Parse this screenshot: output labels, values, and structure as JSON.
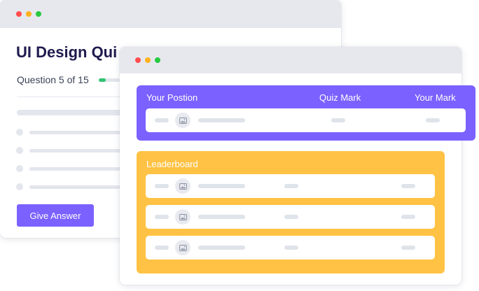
{
  "back_window": {
    "title": "UI Design Qui",
    "question_progress": "Question 5 of 15",
    "progress_fraction": 0.33,
    "answer_button_label": "Give Answer"
  },
  "front_window": {
    "position_table": {
      "col_position": "Your Postion",
      "col_quiz_mark": "Quiz Mark",
      "col_your_mark": "Your Mark"
    },
    "leaderboard": {
      "title": "Leaderboard"
    }
  },
  "icons": {
    "avatar": "image-icon"
  },
  "colors": {
    "accent_purple": "#7b61ff",
    "leaderboard_orange": "#ffc244",
    "progress_green": "#2fc36f",
    "window_close": "#ff4d4d",
    "window_minimize": "#ffb21e",
    "window_maximize": "#27c93f"
  }
}
